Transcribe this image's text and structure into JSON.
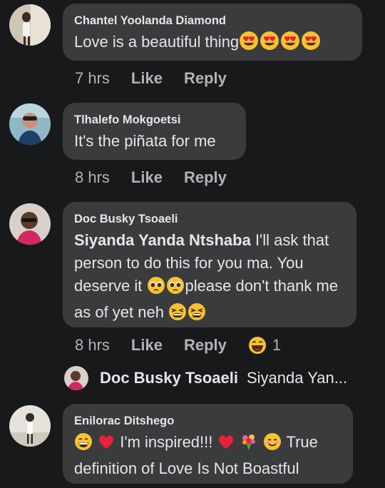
{
  "comments": [
    {
      "author": "Chantel Yoolanda Diamond",
      "text": "Love is a beautiful thing",
      "emoji": [
        "heart-eyes",
        "heart-eyes",
        "heart-eyes",
        "heart-eyes"
      ],
      "time": "7 hrs",
      "like": "Like",
      "reply": "Reply"
    },
    {
      "author": "Tlhalefo Mokgoetsi",
      "text": "It's the piñata for me",
      "time": "8 hrs",
      "like": "Like",
      "reply": "Reply"
    },
    {
      "author": "Doc Busky Tsoaeli",
      "mention": "Siyanda Yanda Ntshaba",
      "text_1": "I'll ask that person to do this for you ma. You deserve it",
      "text_2": "please don't thank me as of yet neh",
      "time": "8 hrs",
      "like": "Like",
      "reply": "Reply",
      "reaction_count": "1"
    },
    {
      "author": "Enilorac Ditshego",
      "text_1": "I'm inspired!!!",
      "text_2": "True definition of Love Is Not Boastful"
    }
  ],
  "reply_preview": {
    "author": "Doc Busky Tsoaeli",
    "text": "Siyanda Yan..."
  },
  "colors": {
    "background": "#18191a",
    "bubble": "#3a3b3c",
    "text": "#e4e6eb",
    "muted": "#b0b3b8"
  }
}
